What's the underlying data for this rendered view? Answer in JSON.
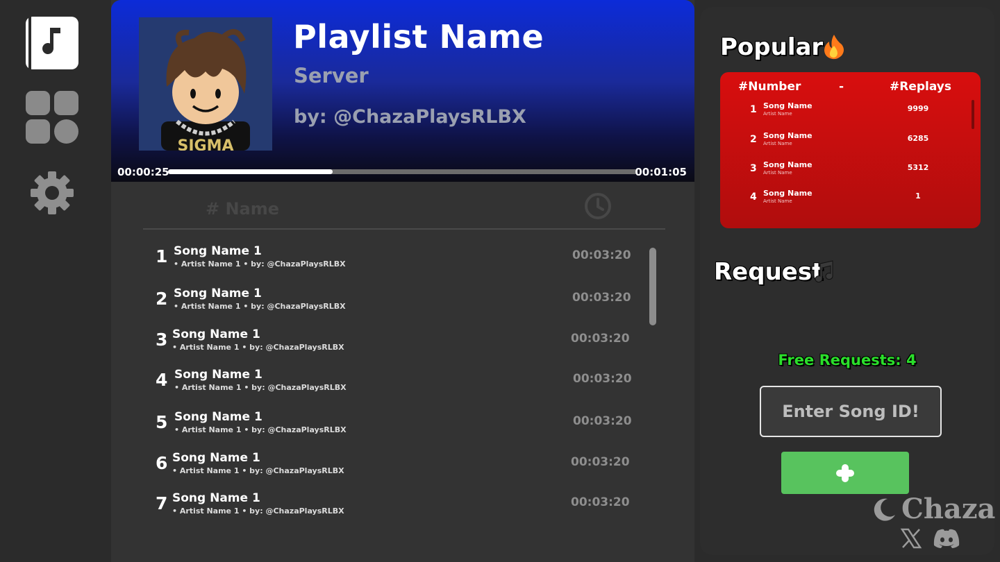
{
  "nav": {
    "items": [
      {
        "name": "music-library",
        "icon": "music-note-book-icon"
      },
      {
        "name": "apps-grid",
        "icon": "grid-icon"
      },
      {
        "name": "settings",
        "icon": "gear-icon"
      }
    ]
  },
  "player": {
    "title": "Playlist Name",
    "subtitle": "Server",
    "by": "by: @ChazaPlaysRLBX",
    "current_time": "00:00:25",
    "total_time": "00:01:05",
    "progress_fraction": 0.35
  },
  "list_header": {
    "name_label": "# Name",
    "duration_icon": "clock-icon"
  },
  "songs": [
    {
      "num": "1",
      "title": "Song Name 1",
      "sub": "• Artist Name 1 • by: @ChazaPlaysRLBX",
      "duration": "00:03:20"
    },
    {
      "num": "2",
      "title": "Song Name 1",
      "sub": "• Artist Name 1 • by: @ChazaPlaysRLBX",
      "duration": "00:03:20"
    },
    {
      "num": "3",
      "title": "Song Name 1",
      "sub": "• Artist Name 1 • by: @ChazaPlaysRLBX",
      "duration": "00:03:20"
    },
    {
      "num": "4",
      "title": "Song Name 1",
      "sub": "• Artist Name 1 • by: @ChazaPlaysRLBX",
      "duration": "00:03:20"
    },
    {
      "num": "5",
      "title": "Song Name 1",
      "sub": "• Artist Name 1 • by: @ChazaPlaysRLBX",
      "duration": "00:03:20"
    },
    {
      "num": "6",
      "title": "Song Name 1",
      "sub": "• Artist Name 1 • by: @ChazaPlaysRLBX",
      "duration": "00:03:20"
    },
    {
      "num": "7",
      "title": "Song Name 1",
      "sub": "• Artist Name 1 • by: @ChazaPlaysRLBX",
      "duration": "00:03:20"
    }
  ],
  "popular": {
    "title": "Popular",
    "icon": "fire-icon",
    "header_number": "#Number",
    "header_dash": "-",
    "header_replays": "#Replays",
    "rows": [
      {
        "rank": "1",
        "song": "Song Name",
        "artist": "Artist Name",
        "replays": "9999"
      },
      {
        "rank": "2",
        "song": "Song Name",
        "artist": "Artist Name",
        "replays": "6285"
      },
      {
        "rank": "3",
        "song": "Song Name",
        "artist": "Artist Name",
        "replays": "5312"
      },
      {
        "rank": "4",
        "song": "Song Name",
        "artist": "Artist Name",
        "replays": "1"
      }
    ]
  },
  "request": {
    "title": "Request",
    "icon": "music-notes-icon",
    "free_requests": "Free Requests: 4",
    "input_placeholder": "Enter Song ID!",
    "input_value": "",
    "add_icon": "plus-icon"
  },
  "branding": {
    "logo_icon": "crescent-moon-icon",
    "name": "Chaza",
    "social": [
      "x-logo-icon",
      "discord-icon"
    ]
  },
  "colors": {
    "header_gradient_top": "#0c2bd8",
    "popular_red": "#d80e0e",
    "add_green": "#58c35e",
    "free_req_green": "#2bdf2b"
  }
}
